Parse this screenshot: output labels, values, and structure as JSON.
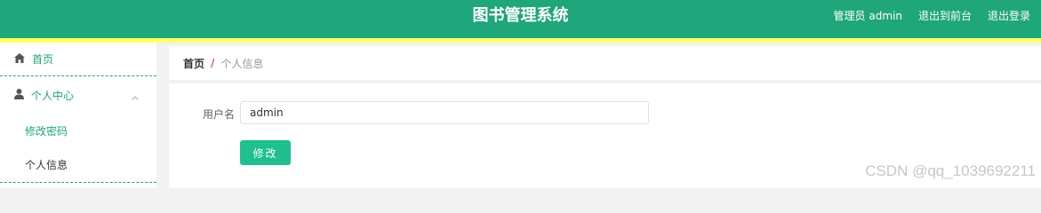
{
  "header": {
    "title": "图书管理系统",
    "admin_label": "管理员 admin",
    "frontend_link": "退出到前台",
    "logout_link": "退出登录"
  },
  "sidebar": {
    "items": [
      {
        "label": "首页",
        "icon": "home-icon"
      },
      {
        "label": "个人中心",
        "icon": "user-icon"
      },
      {
        "label": "修改密码"
      },
      {
        "label": "个人信息"
      }
    ]
  },
  "breadcrumb": {
    "home": "首页",
    "separator": "/",
    "current": "个人信息"
  },
  "form": {
    "username_label": "用户名",
    "username_value": "admin",
    "submit_label": "修改"
  },
  "watermark": "CSDN @qq_1039692211",
  "colors": {
    "primary": "#1fa67a",
    "accent": "#ffff66",
    "button": "#1fbf8f",
    "breadcrumb_separator": "#e05a3c"
  }
}
